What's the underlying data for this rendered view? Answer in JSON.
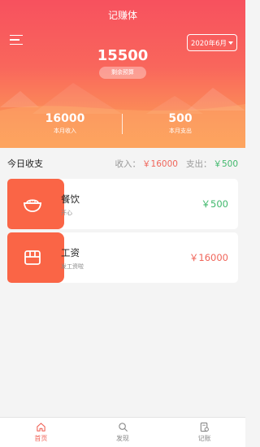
{
  "header": {
    "title": "记赚体",
    "date_selector": "2020年6月",
    "balance": "15500",
    "budget_label": "剩余预算",
    "income": {
      "value": "16000",
      "label": "本月收入"
    },
    "expense": {
      "value": "500",
      "label": "本月支出"
    }
  },
  "today": {
    "title": "今日收支",
    "income_label": "收入：",
    "income_value": "￥16000",
    "expense_label": "支出：",
    "expense_value": "￥500"
  },
  "records": [
    {
      "name": "餐饮",
      "note": "开心",
      "amount": "￥500",
      "type": "expense",
      "icon": "bowl-icon"
    },
    {
      "name": "工资",
      "note": "发工资啦",
      "amount": "￥16000",
      "type": "income",
      "icon": "wallet-icon"
    }
  ],
  "tabs": [
    {
      "label": "首页",
      "icon": "home-icon",
      "active": true
    },
    {
      "label": "发现",
      "icon": "search-icon",
      "active": false
    },
    {
      "label": "记账",
      "icon": "edit-icon",
      "active": false
    }
  ],
  "colors": {
    "accent": "#f0655a",
    "header_top": "#f7515e",
    "header_bottom": "#fc9a57",
    "badge": "#fa6546",
    "expense": "#3fb86b"
  }
}
